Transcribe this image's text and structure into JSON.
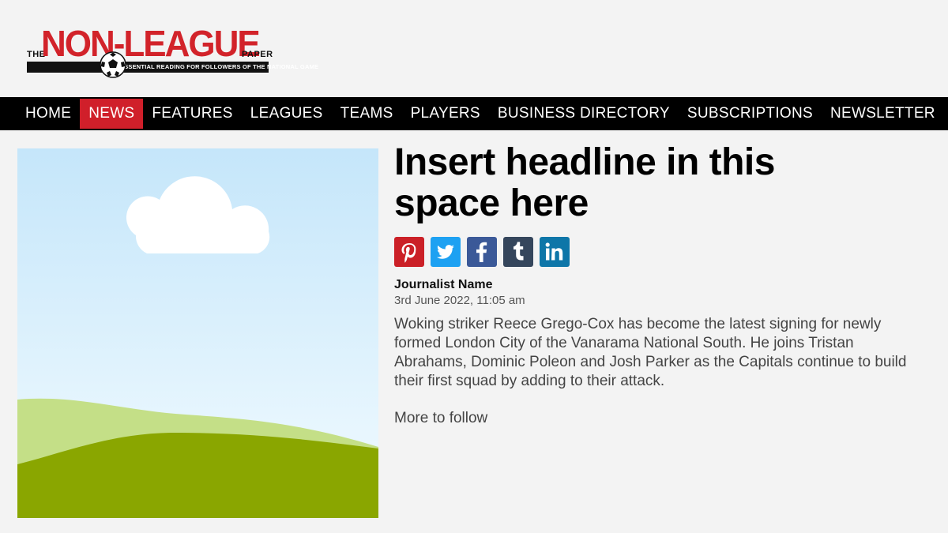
{
  "logo": {
    "the": "THE",
    "title": "NON-LEAGUE",
    "paper": "PAPER",
    "tagline": "ESSENTIAL READING FOR FOLLOWERS OF THE NATIONAL GAME"
  },
  "nav": {
    "items": [
      {
        "label": "HOME"
      },
      {
        "label": "NEWS",
        "active": true
      },
      {
        "label": "FEATURES"
      },
      {
        "label": "LEAGUES"
      },
      {
        "label": "TEAMS"
      },
      {
        "label": "PLAYERS"
      },
      {
        "label": "BUSINESS DIRECTORY"
      },
      {
        "label": "SUBSCRIPTIONS"
      },
      {
        "label": "NEWSLETTER"
      }
    ],
    "active_color": "#d01f2a"
  },
  "article": {
    "headline": "Insert headline in this space here",
    "share": [
      {
        "icon": "pinterest-icon",
        "color": "#cb2027"
      },
      {
        "icon": "twitter-icon",
        "color": "#1da1f2"
      },
      {
        "icon": "facebook-icon",
        "color": "#3b5998"
      },
      {
        "icon": "tumblr-icon",
        "color": "#35465c"
      },
      {
        "icon": "linkedin-icon",
        "color": "#0e76a8"
      }
    ],
    "author": "Journalist Name",
    "date": "3rd June 2022, 11:05 am",
    "body": "Woking striker Reece Grego-Cox has become the latest signing for newly formed London City of the Vanarama National South. He joins Tristan Abrahams, Dominic Poleon and Josh Parker as the Capitals continue to build their first squad by adding to their attack.",
    "more": "More to follow"
  },
  "colors": {
    "brand_red": "#d2232a",
    "nav_bg": "#000000",
    "page_bg": "#f3f3f3"
  }
}
